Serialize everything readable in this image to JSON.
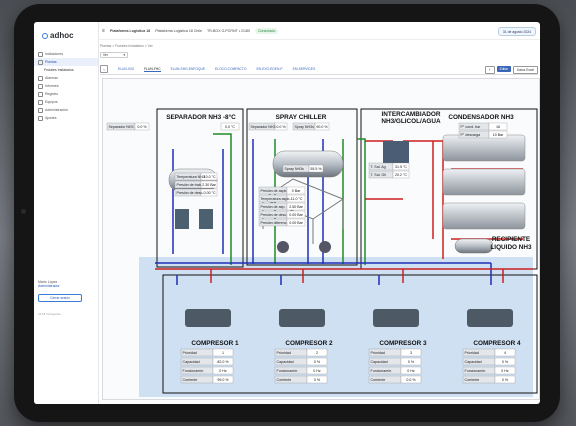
{
  "app": {
    "logo": "adhoc"
  },
  "topbar": {
    "platform": "Plataforma Logistica 18",
    "location": "Plataforma Logistica 18 Chile",
    "device": "TR-BOX G.PCRNT • 2/180",
    "status": "Conectado",
    "date": "31 de agosto 2024"
  },
  "sidebar": {
    "items": [
      {
        "label": "Indicadores"
      },
      {
        "label": "Plantas"
      },
      {
        "label": "Frutales Instalados"
      },
      {
        "label": "Alarmas"
      },
      {
        "label": "Informes"
      },
      {
        "label": "Registro"
      },
      {
        "label": "Equipos"
      },
      {
        "label": "Administración"
      },
      {
        "label": "Ajustes"
      }
    ],
    "user": "Mario López",
    "role": "Administrador",
    "logout": "Cerrar sesión",
    "version": "v2.18 Incluyendo"
  },
  "breadcrumb": "Plantas  >  Frutales Instalados  >  Ver",
  "select": {
    "value": "Ver"
  },
  "tabs": [
    "ELUN-G02",
    "FLUN-FHC",
    "ELUN-SHG-ENFOQUE",
    "ELOCO-COMPACTO",
    "EN-EXO-EDEN-P",
    "EM-SERVICES"
  ],
  "buttons": {
    "edit": "Editar",
    "excel": "Datos Excel"
  },
  "colors": {
    "supply": "#cc1f1f",
    "return": "#1f2fb8",
    "glycol": "#1f8a2a",
    "water": "#d33d3d"
  },
  "panels": {
    "separador": {
      "title": "SEPARADOR NH3 -8°C",
      "level_label": "Separador NH3",
      "level_val": "0.0 %",
      "temp_right": "0.0 °C",
      "rows": [
        {
          "k": "Temperatura NH3",
          "v": "-10.0 °C"
        },
        {
          "k": "Presión de trab.",
          "v": "2.30 Bar"
        },
        {
          "k": "Presión de desc.",
          "v": "-0.00 °C"
        }
      ]
    },
    "spray": {
      "title": "SPRAY CHILLER",
      "level_label": "Separador NH3",
      "level_val": "0.0 %",
      "pump_label": "Spray NH3s",
      "pump_val": "90.0 %",
      "tank_label": "Spray NH3s",
      "tank_val": "55.5 %",
      "rows": [
        {
          "k": "Presión de aspir.",
          "v": "0 Bar"
        },
        {
          "k": "Temperatura aspir.",
          "v": "-11.0 °C"
        },
        {
          "k": "Presión de asp.",
          "v": "2.50 Bar"
        },
        {
          "k": "Presión de desc.",
          "v": "0.00 Bar"
        },
        {
          "k": "Presión diferenc.",
          "v": "0.00 Bar"
        }
      ]
    },
    "intercambiador": {
      "title1": "INTERCAMBIADOR",
      "title2": "NH3/GLICOL/AGUA",
      "rows": [
        {
          "k": "T. Sal. Ag",
          "v": "31.5 °C"
        },
        {
          "k": "T. Sal. Gli",
          "v": "20.2 °C"
        }
      ]
    },
    "condensador": {
      "title": "CONDENSADOR NH3",
      "rows": [
        {
          "k": "P° cond. bar",
          "v": "16"
        },
        {
          "k": "P° descarga",
          "v": "10 Bar"
        }
      ],
      "receiver1": "RECIPIENTE",
      "receiver2": "LIQUIDO NH3"
    }
  },
  "compressors": [
    {
      "title": "COMPRESOR 1",
      "rows": [
        {
          "k": "Prioridad",
          "v": "1"
        },
        {
          "k": "Capacidad",
          "v": "82.0 %"
        },
        {
          "k": "Funcionamie.",
          "v": "0 Hz"
        },
        {
          "k": "Corriente",
          "v": "99.0 %"
        }
      ]
    },
    {
      "title": "COMPRESOR 2",
      "rows": [
        {
          "k": "Prioridad",
          "v": "2"
        },
        {
          "k": "Capacidad",
          "v": "0 %"
        },
        {
          "k": "Funcionamie.",
          "v": "0 Hz"
        },
        {
          "k": "Corriente",
          "v": "0 %"
        }
      ]
    },
    {
      "title": "COMPRESOR 3",
      "rows": [
        {
          "k": "Prioridad",
          "v": "3"
        },
        {
          "k": "Capacidad",
          "v": "0 %"
        },
        {
          "k": "Funcionamie.",
          "v": "0 Hz"
        },
        {
          "k": "Corriente",
          "v": "0.0 %"
        }
      ]
    },
    {
      "title": "COMPRESOR 4",
      "rows": [
        {
          "k": "Prioridad",
          "v": "4"
        },
        {
          "k": "Capacidad",
          "v": "0 %"
        },
        {
          "k": "Funcionamie.",
          "v": "0 Hz"
        },
        {
          "k": "Corriente",
          "v": "0 %"
        }
      ]
    }
  ]
}
